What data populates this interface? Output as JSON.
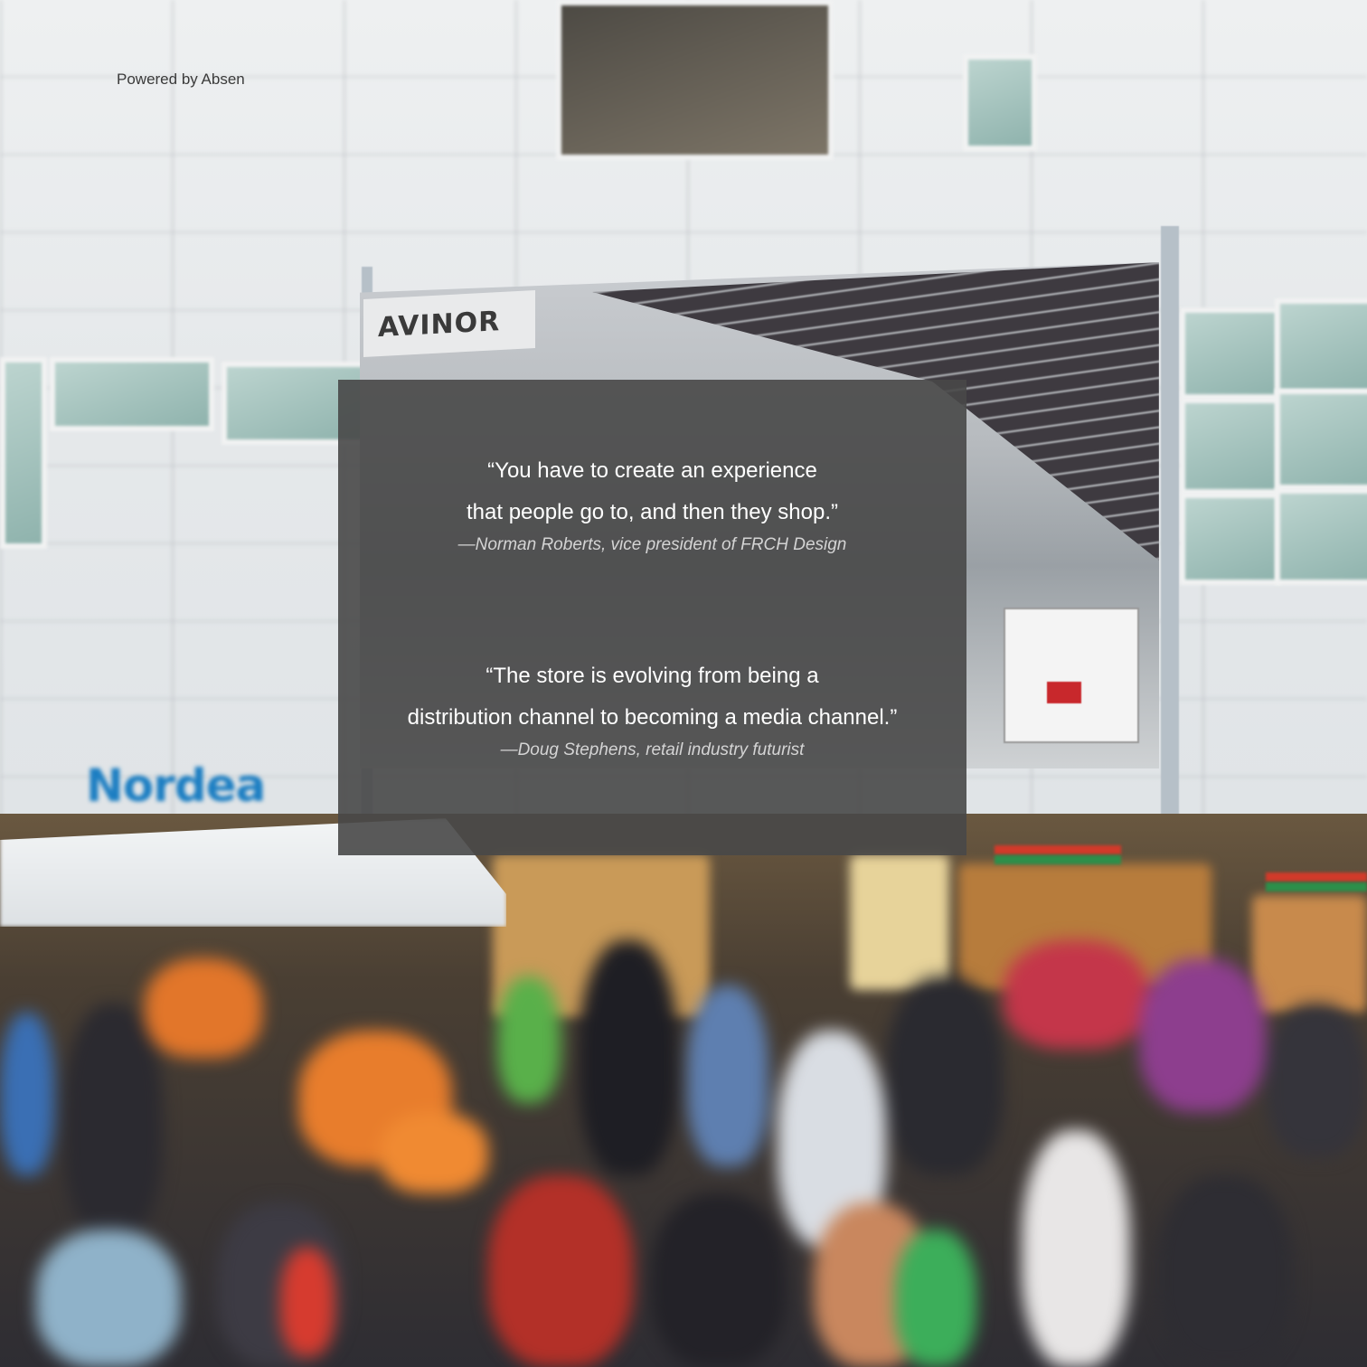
{
  "header": {
    "powered_by": "Powered by Absen"
  },
  "scene": {
    "screen_logo": "AVINOR",
    "bank_sign": "Nordea"
  },
  "quotes": [
    {
      "lines": [
        "“You have to create an experience",
        "that people go to, and then they shop.”"
      ],
      "attribution": "—Norman Roberts, vice president of FRCH Design"
    },
    {
      "lines": [
        "“The store is evolving from being a",
        "distribution channel to becoming a media channel.”"
      ],
      "attribution": "—Doug Stephens, retail industry futurist"
    }
  ],
  "colors": {
    "panel": "#484848",
    "quote_text": "#ffffff",
    "attribution_text": "#d4d4d4",
    "brand_blue": "#1c7ec2"
  }
}
